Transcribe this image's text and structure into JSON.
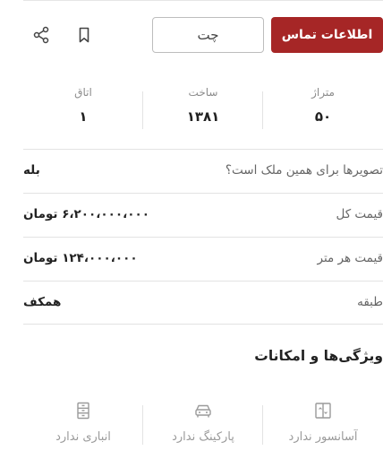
{
  "actions": {
    "contact_label": "اطلاعات تماس",
    "chat_label": "چت",
    "bookmark_icon": "bookmark-icon",
    "share_icon": "share-icon"
  },
  "stats": [
    {
      "label": "متراژ",
      "value": "۵۰"
    },
    {
      "label": "ساخت",
      "value": "۱۳۸۱"
    },
    {
      "label": "اتاق",
      "value": "۱"
    }
  ],
  "details": [
    {
      "key": "تصویرها برای همین ملک است؟",
      "value": "بله"
    },
    {
      "key": "قیمت کل",
      "value": "۶،۲۰۰،۰۰۰،۰۰۰ تومان"
    },
    {
      "key": "قیمت هر متر",
      "value": "۱۲۴،۰۰۰،۰۰۰ تومان"
    },
    {
      "key": "طبقه",
      "value": "همکف"
    }
  ],
  "features": {
    "title": "ویژگی‌ها و امکانات",
    "items": [
      {
        "label": "آسانسور ندارد",
        "icon": "elevator-icon"
      },
      {
        "label": "پارکینگ ندارد",
        "icon": "car-icon"
      },
      {
        "label": "انباری ندارد",
        "icon": "storage-icon"
      }
    ]
  },
  "colors": {
    "primary": "#a62626",
    "muted_text": "#8c8c8c",
    "divider": "#e3e3e3"
  }
}
